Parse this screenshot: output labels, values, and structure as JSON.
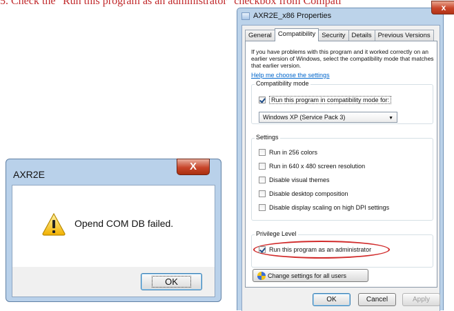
{
  "instruction": "5. Check the \"Run this program as an administrator\" checkbox from Compati",
  "properties_dialog": {
    "title": "AXR2E_x86 Properties",
    "close_label": "x",
    "tabs": [
      {
        "label": "General"
      },
      {
        "label": "Compatibility"
      },
      {
        "label": "Security"
      },
      {
        "label": "Details"
      },
      {
        "label": "Previous Versions"
      }
    ],
    "active_tab": "Compatibility",
    "intro_text": "If you have problems with this program and it worked correctly on an earlier version of Windows, select the compatibility mode that matches that earlier version.",
    "help_link": "Help me choose the settings",
    "compat_mode": {
      "title": "Compatibility mode",
      "checkbox_label": "Run this program in compatibility mode for:",
      "checked": true,
      "selected_os": "Windows XP (Service Pack 3)"
    },
    "settings": {
      "title": "Settings",
      "options": [
        {
          "label": "Run in 256 colors",
          "checked": false
        },
        {
          "label": "Run in 640 x 480 screen resolution",
          "checked": false
        },
        {
          "label": "Disable visual themes",
          "checked": false
        },
        {
          "label": "Disable desktop composition",
          "checked": false
        },
        {
          "label": "Disable display scaling on high DPI settings",
          "checked": false
        }
      ]
    },
    "privilege": {
      "title": "Privilege Level",
      "checkbox_label": "Run this program as an administrator",
      "checked": true
    },
    "change_settings_button": "Change settings for all users",
    "buttons": {
      "ok": "OK",
      "cancel": "Cancel",
      "apply": "Apply"
    },
    "highlight_color": "#d12b2b"
  },
  "message_box": {
    "title": "AXR2E",
    "close_label": "X",
    "message": "Opend COM DB failed.",
    "ok_label": "OK",
    "icon": "warning-icon"
  }
}
